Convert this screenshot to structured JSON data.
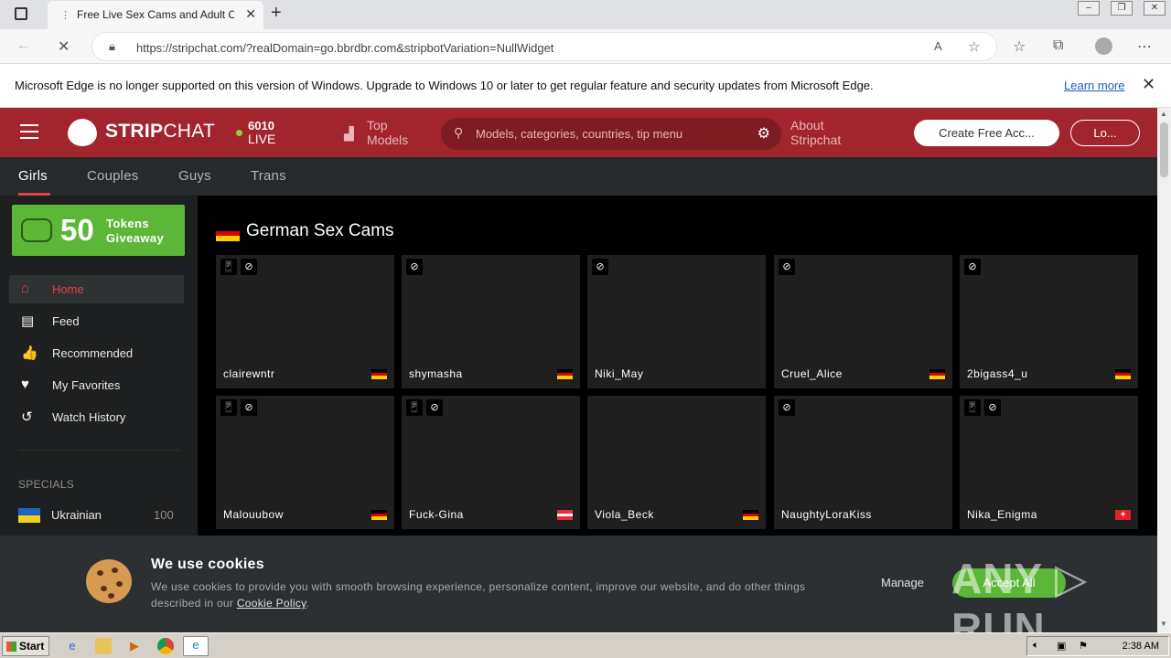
{
  "browser": {
    "tab_title": "Free Live Sex Cams and Adult Ch",
    "tab_close": "✕",
    "new_tab": "+",
    "url": "https://stripchat.com/?realDomain=go.bbrdbr.com&stripbotVariation=NullWidget",
    "window_buttons": [
      "–",
      "❐",
      "✕"
    ]
  },
  "edge_notice": {
    "message": "Microsoft Edge is no longer supported on this version of Windows. Upgrade to Windows 10 or later to get regular feature and security updates from Microsoft Edge.",
    "learn_more": "Learn more",
    "close": "✕"
  },
  "header": {
    "logo_bold": "STRIP",
    "logo_thin": "CHAT",
    "live_count": "6010",
    "live_label": "LIVE",
    "top_models_line1": "Top",
    "top_models_line2": "Models",
    "search_placeholder": "Models, categories, countries, tip menu",
    "about_line1": "About",
    "about_line2": "Stripchat",
    "create_account": "Create Free Acc...",
    "login": "Lo..."
  },
  "categories": [
    "Girls",
    "Couples",
    "Guys",
    "Trans"
  ],
  "sidebar": {
    "giveaway_number": "50",
    "giveaway_line1": "Tokens",
    "giveaway_line2": "Giveaway",
    "items": [
      {
        "label": "Home",
        "icon": "home-icon",
        "glyph": "⌂"
      },
      {
        "label": "Feed",
        "icon": "feed-icon",
        "glyph": "▤"
      },
      {
        "label": "Recommended",
        "icon": "thumbs-up-icon",
        "glyph": "👍"
      },
      {
        "label": "My Favorites",
        "icon": "heart-icon",
        "glyph": "♥"
      },
      {
        "label": "Watch History",
        "icon": "history-icon",
        "glyph": "↺"
      }
    ],
    "specials_title": "SPECIALS",
    "specials": [
      {
        "label": "Ukrainian",
        "count": "100"
      }
    ]
  },
  "section": {
    "title": "German Sex Cams",
    "cards": [
      {
        "name": "clairewntr",
        "badges": [
          "📱",
          "⊘"
        ],
        "flag": "de"
      },
      {
        "name": "shymasha",
        "badges": [
          "⊘"
        ],
        "flag": "de"
      },
      {
        "name": "Niki_May",
        "badges": [
          "⊘"
        ],
        "flag": ""
      },
      {
        "name": "Cruel_Alice",
        "badges": [
          "⊘"
        ],
        "flag": "de"
      },
      {
        "name": "2bigass4_u",
        "badges": [
          "⊘"
        ],
        "flag": "de"
      },
      {
        "name": "Malouubow",
        "badges": [
          "📱",
          "⊘"
        ],
        "flag": "de"
      },
      {
        "name": "Fuck-Gina",
        "badges": [
          "📱",
          "⊘"
        ],
        "flag": "at"
      },
      {
        "name": "Viola_Beck",
        "badges": [],
        "flag": "de"
      },
      {
        "name": "NaughtyLoraKiss",
        "badges": [
          "⊘"
        ],
        "flag": ""
      },
      {
        "name": "Nika_Enigma",
        "badges": [
          "📱",
          "⊘"
        ],
        "flag": "ch"
      }
    ]
  },
  "cookie_banner": {
    "title": "We use cookies",
    "description": "We use cookies to provide you with smooth browsing experience, personalize content, improve our website, and do other things described in our",
    "policy_link": "Cookie Policy",
    "manage": "Manage",
    "accept": "Accept All"
  },
  "watermark": "ANY ▷ RUN",
  "taskbar": {
    "start": "Start",
    "clock": "2:38 AM"
  },
  "colors": {
    "header_red": "#a2252d",
    "accent_red": "#e6404a",
    "giveaway_green": "#5cb638",
    "flag_de": [
      "#000000",
      "#dd0000",
      "#ffce00"
    ],
    "flag_at": [
      "#ed2939",
      "#ffffff",
      "#ed2939"
    ]
  }
}
